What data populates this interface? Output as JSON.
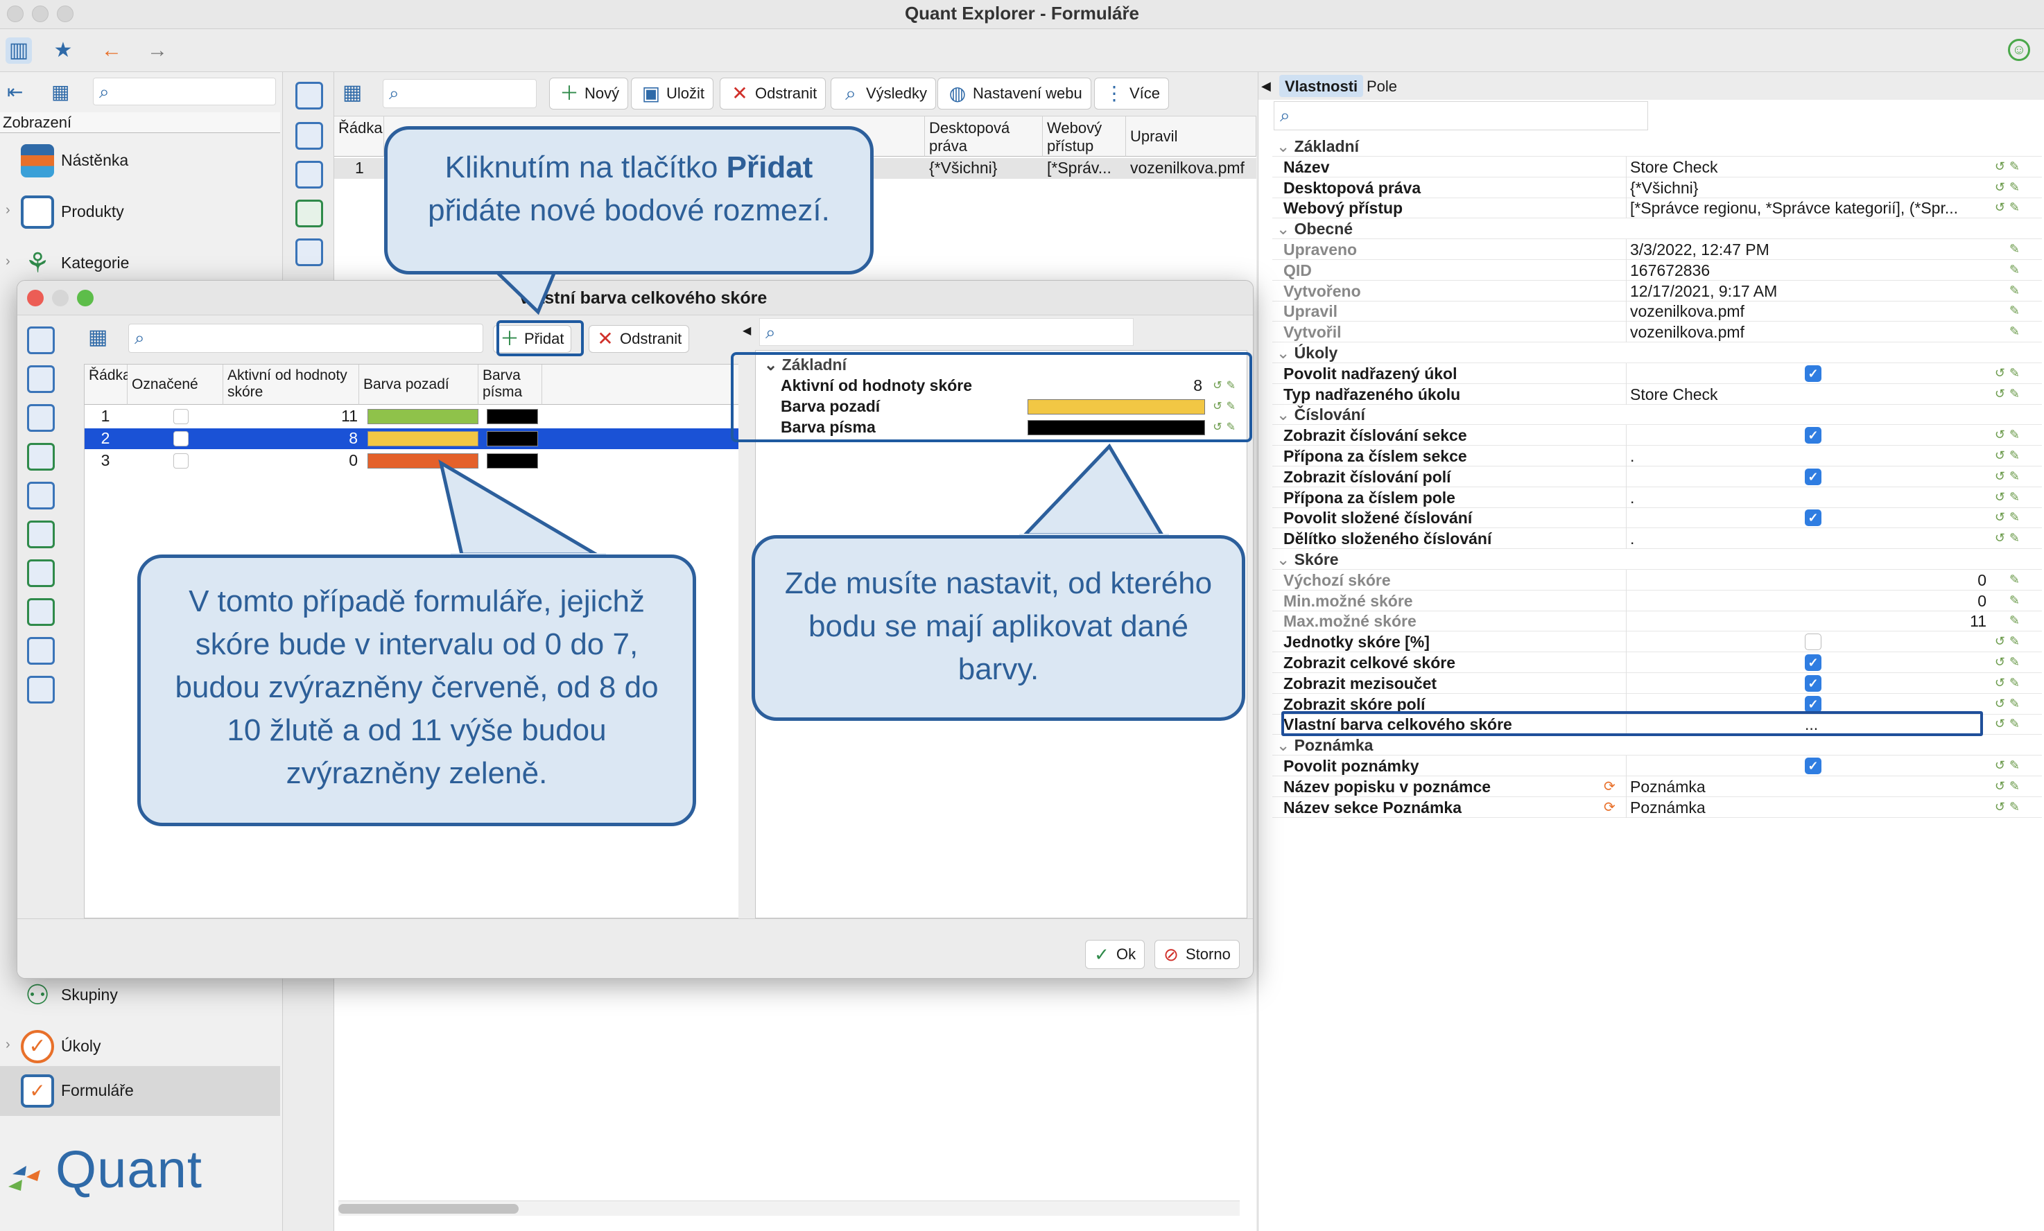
{
  "app": {
    "title": "Quant Explorer - Formuláře"
  },
  "sidebar": {
    "header": "Zobrazení",
    "items": [
      {
        "label": "Nástěnka"
      },
      {
        "label": "Produkty"
      },
      {
        "label": "Kategorie"
      },
      {
        "label": "Skupiny"
      },
      {
        "label": "Úkoly"
      },
      {
        "label": "Formuláře"
      }
    ],
    "logo_text": "Quant"
  },
  "main": {
    "toolbar": {
      "new": "Nový",
      "save": "Uložit",
      "delete": "Odstranit",
      "results": "Výsledky",
      "web_settings": "Nastavení webu",
      "more": "Více"
    },
    "columns": {
      "radka": "Řádka",
      "desktop_rights": "Desktopová práva",
      "web_access": "Webový přístup",
      "modified_by": "Upravil"
    },
    "row": {
      "num": "1",
      "desktop": "{*Všichni}",
      "web": "[*Správ...",
      "modified": "vozenilkova.pmf"
    }
  },
  "dialog": {
    "title": "Vlastní barva celkového skóre",
    "add_button": "Přidat",
    "delete_button": "Odstranit",
    "columns": {
      "row": "Řádka",
      "marked": "Označené",
      "active_from": "Aktivní od hodnoty skóre",
      "bg_color": "Barva pozadí",
      "font_color": "Barva písma"
    },
    "rows": [
      {
        "num": "1",
        "value": "11",
        "bg": "#8fc24a",
        "fg": "#000000"
      },
      {
        "num": "2",
        "value": "8",
        "bg": "#f2c744",
        "fg": "#000000"
      },
      {
        "num": "3",
        "value": "0",
        "bg": "#e4612b",
        "fg": "#000000"
      }
    ],
    "right": {
      "section": "Základní",
      "active_from_label": "Aktivní od hodnoty skóre",
      "active_from_value": "8",
      "bg_label": "Barva pozadí",
      "bg_color": "#f2c744",
      "font_label": "Barva písma",
      "font_color": "#000000"
    },
    "ok": "Ok",
    "cancel": "Storno"
  },
  "props": {
    "tabs": [
      "Vlastnosti",
      "Pole"
    ],
    "rows": [
      {
        "name": "Základní",
        "type": "section"
      },
      {
        "name": "Název",
        "value": "Store Check"
      },
      {
        "name": "Desktopová práva",
        "value": "{*Všichni}"
      },
      {
        "name": "Webový přístup",
        "value": "[*Správce regionu, *Správce kategorií], (*Spr..."
      },
      {
        "name": "Obecné",
        "type": "section"
      },
      {
        "name": "Upraveno",
        "value": "3/3/2022, 12:47 PM",
        "grey": true
      },
      {
        "name": "QID",
        "value": "167672836",
        "grey": true
      },
      {
        "name": "Vytvořeno",
        "value": "12/17/2021, 9:17 AM",
        "grey": true
      },
      {
        "name": "Upravil",
        "value": "vozenilkova.pmf",
        "grey": true
      },
      {
        "name": "Vytvořil",
        "value": "vozenilkova.pmf",
        "grey": true
      },
      {
        "name": "Úkoly",
        "type": "section"
      },
      {
        "name": "Povolit nadřazený úkol",
        "check": true
      },
      {
        "name": "Typ nadřazeného úkolu",
        "value": "Store Check"
      },
      {
        "name": "Číslování",
        "type": "section"
      },
      {
        "name": "Zobrazit číslování sekce",
        "check": true
      },
      {
        "name": "Přípona za číslem sekce",
        "value": "."
      },
      {
        "name": "Zobrazit číslování polí",
        "check": true
      },
      {
        "name": "Přípona za číslem pole",
        "value": "."
      },
      {
        "name": "Povolit složené číslování",
        "check": true
      },
      {
        "name": "Dělítko složeného číslování",
        "value": "."
      },
      {
        "name": "Skóre",
        "type": "section"
      },
      {
        "name": "Výchozí skóre",
        "num": "0",
        "grey": true
      },
      {
        "name": "Min.možné skóre",
        "num": "0",
        "grey": true
      },
      {
        "name": "Max.možné skóre",
        "num": "11",
        "grey": true
      },
      {
        "name": "Jednotky skóre [%]",
        "check": false
      },
      {
        "name": "Zobrazit celkové skóre",
        "check": true
      },
      {
        "name": "Zobrazit mezisoučet",
        "check": true
      },
      {
        "name": "Zobrazit skóre polí",
        "check": true
      },
      {
        "name": "Vlastní barva celkového skóre",
        "value": "..."
      },
      {
        "name": "Poznámka",
        "type": "section"
      },
      {
        "name": "Povolit poznámky",
        "check": true
      },
      {
        "name": "Název popisku v poznámce",
        "value": "Poznámka"
      },
      {
        "name": "Název sekce Poznámka",
        "value": "Poznámka"
      }
    ]
  },
  "callouts": {
    "top_pre": "Kliknutím na tlačítko ",
    "top_bold": "Přidat",
    "top_post": "přidáte nové bodové rozmezí.",
    "left": "V tomto případě formuláře, jejichž skóre bude v intervalu od 0 do 7, budou zvýrazněny červeně, od 8 do 10 žlutě a od 11 výše budou zvýrazněny zeleně.",
    "right": "Zde musíte nastavit, od kterého bodu se mají aplikovat dané barvy."
  }
}
